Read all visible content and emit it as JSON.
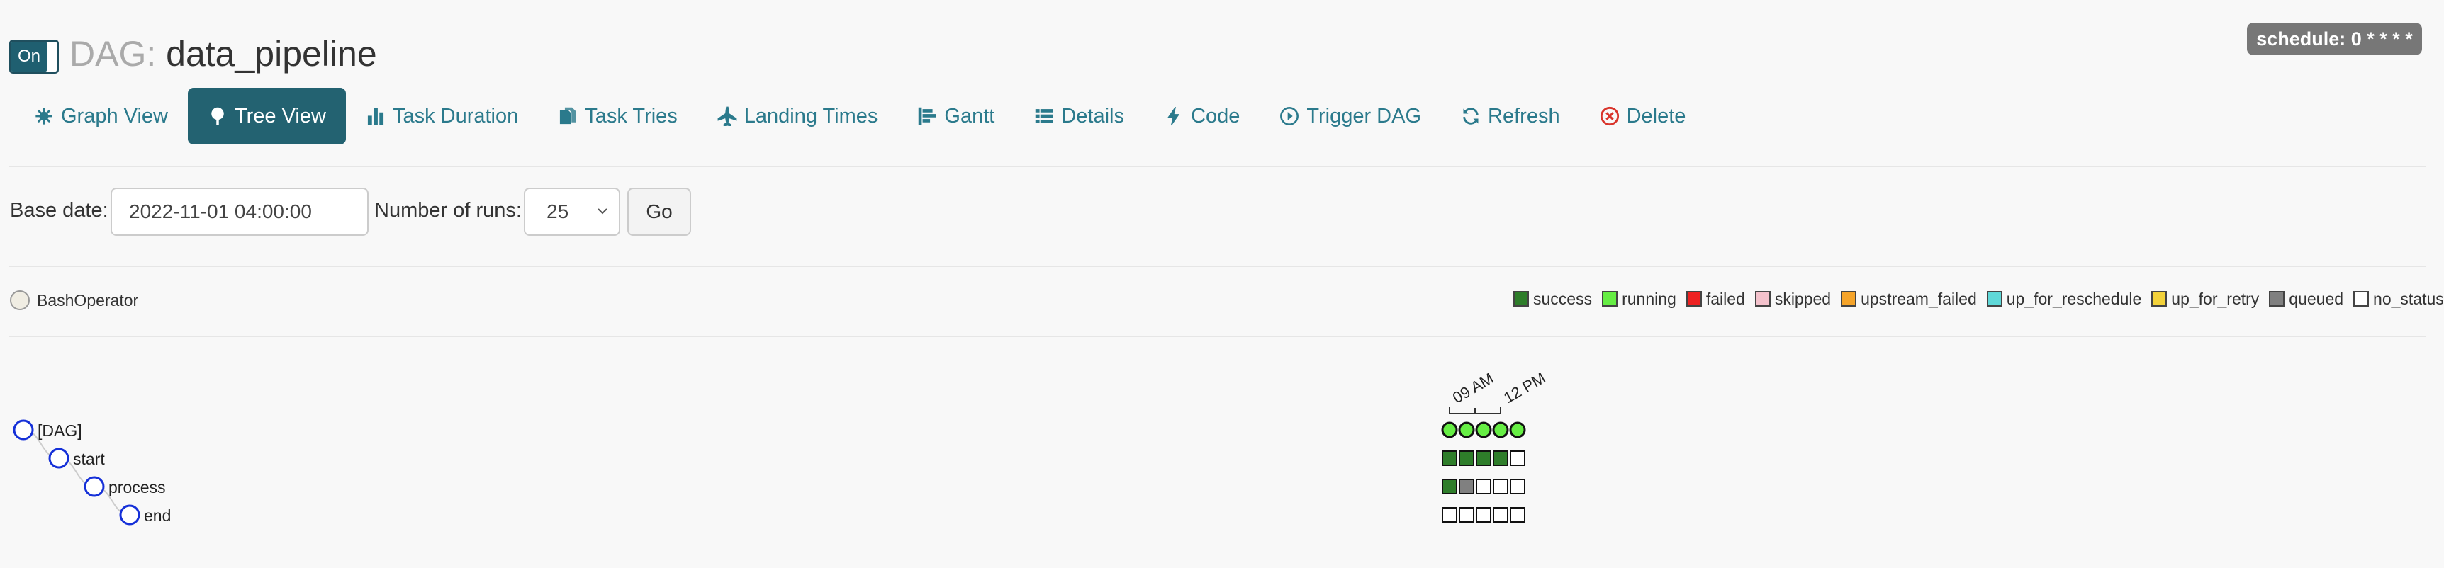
{
  "header": {
    "toggle_label": "On",
    "title_prefix": "DAG:",
    "dag_name": "data_pipeline",
    "schedule": "schedule: 0 * * * *"
  },
  "nav": [
    {
      "label": "Graph View",
      "icon": "graph-icon",
      "active": false
    },
    {
      "label": "Tree View",
      "icon": "tree-icon",
      "active": true
    },
    {
      "label": "Task Duration",
      "icon": "bar-chart-icon",
      "active": false
    },
    {
      "label": "Task Tries",
      "icon": "duplicate-icon",
      "active": false
    },
    {
      "label": "Landing Times",
      "icon": "plane-icon",
      "active": false
    },
    {
      "label": "Gantt",
      "icon": "align-left-icon",
      "active": false
    },
    {
      "label": "Details",
      "icon": "list-icon",
      "active": false
    },
    {
      "label": "Code",
      "icon": "flash-icon",
      "active": false
    },
    {
      "label": "Trigger DAG",
      "icon": "play-circle-icon",
      "active": false
    },
    {
      "label": "Refresh",
      "icon": "refresh-icon",
      "active": false
    },
    {
      "label": "Delete",
      "icon": "remove-circle-icon",
      "active": false
    }
  ],
  "controls": {
    "base_date_label": "Base date:",
    "base_date_value": "2022-11-01 04:00:00",
    "num_runs_label": "Number of runs:",
    "num_runs_value": "25",
    "go_label": "Go"
  },
  "operators": [
    {
      "label": "BashOperator",
      "color": "#f0ede3"
    }
  ],
  "legend": [
    {
      "label": "success",
      "color": "#2e7d2a"
    },
    {
      "label": "running",
      "color": "#66ee44"
    },
    {
      "label": "failed",
      "color": "#ee2222"
    },
    {
      "label": "skipped",
      "color": "#f4c2cc"
    },
    {
      "label": "upstream_failed",
      "color": "#f5a42a"
    },
    {
      "label": "up_for_reschedule",
      "color": "#5fd8d8"
    },
    {
      "label": "up_for_retry",
      "color": "#f3d23a"
    },
    {
      "label": "queued",
      "color": "#808080"
    },
    {
      "label": "no_status",
      "color": "#ffffff"
    }
  ],
  "tree": {
    "time_labels": [
      "09 AM",
      "12 PM"
    ],
    "nodes": [
      {
        "label": "[DAG]",
        "depth": 0
      },
      {
        "label": "start",
        "depth": 1
      },
      {
        "label": "process",
        "depth": 2
      },
      {
        "label": "end",
        "depth": 3
      }
    ],
    "dag_runs": [
      "running",
      "running",
      "running",
      "running",
      "running"
    ],
    "task_rows": [
      [
        "success",
        "success",
        "success",
        "success",
        "no_status"
      ],
      [
        "success",
        "queued",
        "no_status",
        "no_status",
        "no_status"
      ],
      [
        "no_status",
        "no_status",
        "no_status",
        "no_status",
        "no_status"
      ]
    ]
  }
}
